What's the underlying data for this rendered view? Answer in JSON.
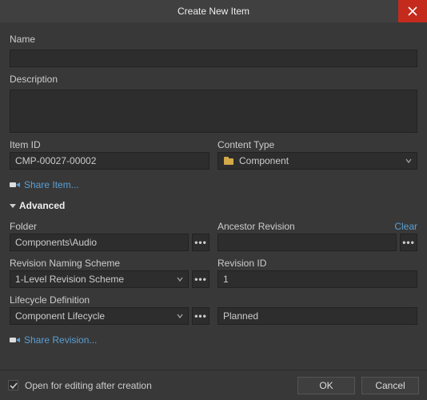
{
  "title": "Create New Item",
  "labels": {
    "name": "Name",
    "description": "Description",
    "itemId": "Item ID",
    "contentType": "Content Type",
    "folder": "Folder",
    "ancestorRevision": "Ancestor Revision",
    "revisionNamingScheme": "Revision Naming Scheme",
    "revisionId": "Revision ID",
    "lifecycleDefinition": "Lifecycle Definition"
  },
  "values": {
    "name": "",
    "description": "",
    "itemId": "CMP-00027-00002",
    "contentType": "Component",
    "folder": "Components\\Audio",
    "ancestorRevision": "",
    "revisionNamingScheme": "1-Level Revision Scheme",
    "revisionId": "1",
    "lifecycleDefinition": "Component Lifecycle",
    "lifecycleState": "Planned"
  },
  "links": {
    "shareItem": "Share Item...",
    "shareRevision": "Share Revision...",
    "clear": "Clear"
  },
  "section": {
    "advanced": "Advanced"
  },
  "footer": {
    "openAfter": "Open for editing after creation",
    "ok": "OK",
    "cancel": "Cancel"
  },
  "ellipsis": "•••"
}
